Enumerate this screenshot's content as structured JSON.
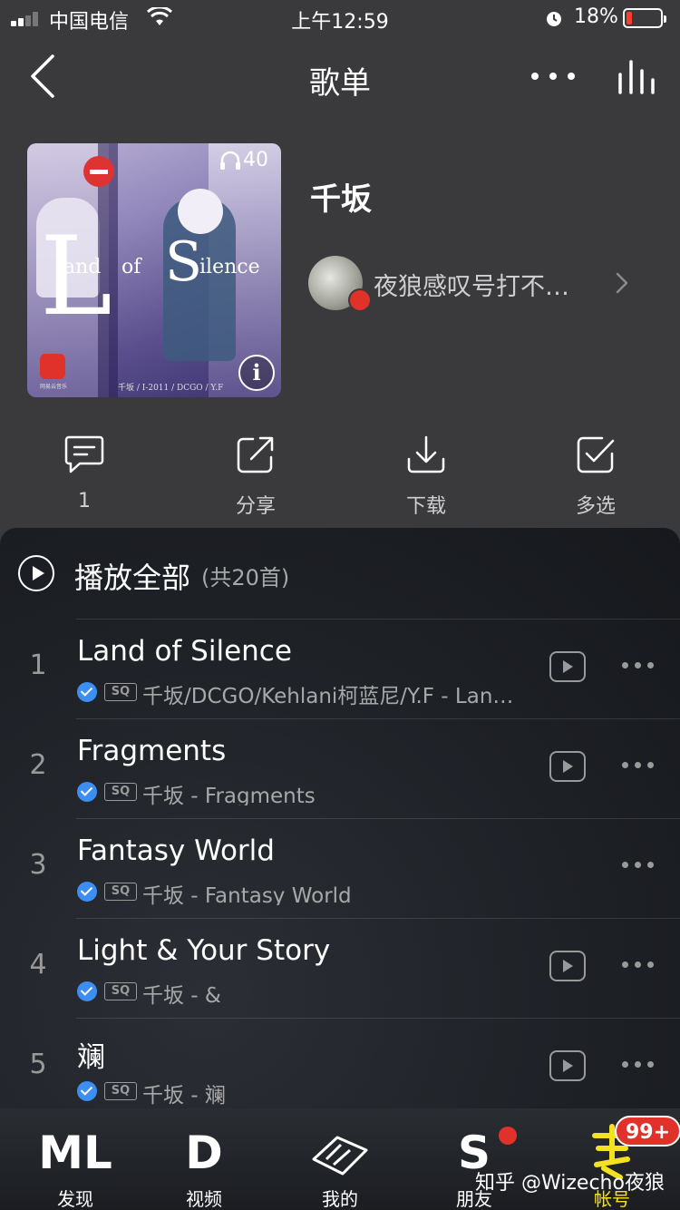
{
  "status_bar": {
    "carrier": "中国电信",
    "time": "上午12:59",
    "battery_percent": "18%",
    "battery_level": 0.18,
    "battery_color": "#ff3b30"
  },
  "nav": {
    "title": "歌单",
    "back_icon": "chevron-left-icon",
    "more_icon": "more-horizontal-icon",
    "equalizer_icon": "equalizer-icon"
  },
  "playlist": {
    "cover": {
      "play_count": "40",
      "title_big_L": "L",
      "title_word_1": "and",
      "title_word_2": "of",
      "title_big_S": "S",
      "title_word_3": "ilence",
      "caption": "千坂 / I-2011 / DCGO / Y.F",
      "logo_text": "网易云音乐"
    },
    "title": "千坂",
    "creator": "夜狼感叹号打不…"
  },
  "actions": [
    {
      "icon": "comment-icon",
      "label": "1"
    },
    {
      "icon": "share-icon",
      "label": "分享"
    },
    {
      "icon": "download-icon",
      "label": "下载"
    },
    {
      "icon": "multi-select-icon",
      "label": "多选"
    }
  ],
  "list": {
    "play_all_label": "播放全部",
    "play_all_count": "(共20首)",
    "quality_badge": "SQ",
    "songs": [
      {
        "index": "1",
        "title": "Land of Silence",
        "subtitle": "千坂/DCGO/Kehlani柯蓝尼/Y.F - Lan…",
        "has_mv": true
      },
      {
        "index": "2",
        "title": "Fragments",
        "subtitle": "千坂 - Fragments",
        "has_mv": true
      },
      {
        "index": "3",
        "title": "Fantasy World",
        "subtitle": "千坂 - Fantasy World",
        "has_mv": false
      },
      {
        "index": "4",
        "title": "Light & Your Story",
        "subtitle": "千坂 - &",
        "has_mv": true
      },
      {
        "index": "5",
        "title": "斓",
        "subtitle": "千坂 - 斓",
        "has_mv": true
      }
    ]
  },
  "tabbar": {
    "tabs": [
      {
        "glyph": "ML",
        "label": "发现"
      },
      {
        "glyph": "D",
        "label": "视频"
      },
      {
        "glyph": "",
        "label": "我的"
      },
      {
        "glyph": "S",
        "label": "朋友"
      },
      {
        "glyph": "",
        "label": "帐号"
      }
    ],
    "account_badge": "99+"
  },
  "watermark": "知乎 @Wizecho夜狼"
}
